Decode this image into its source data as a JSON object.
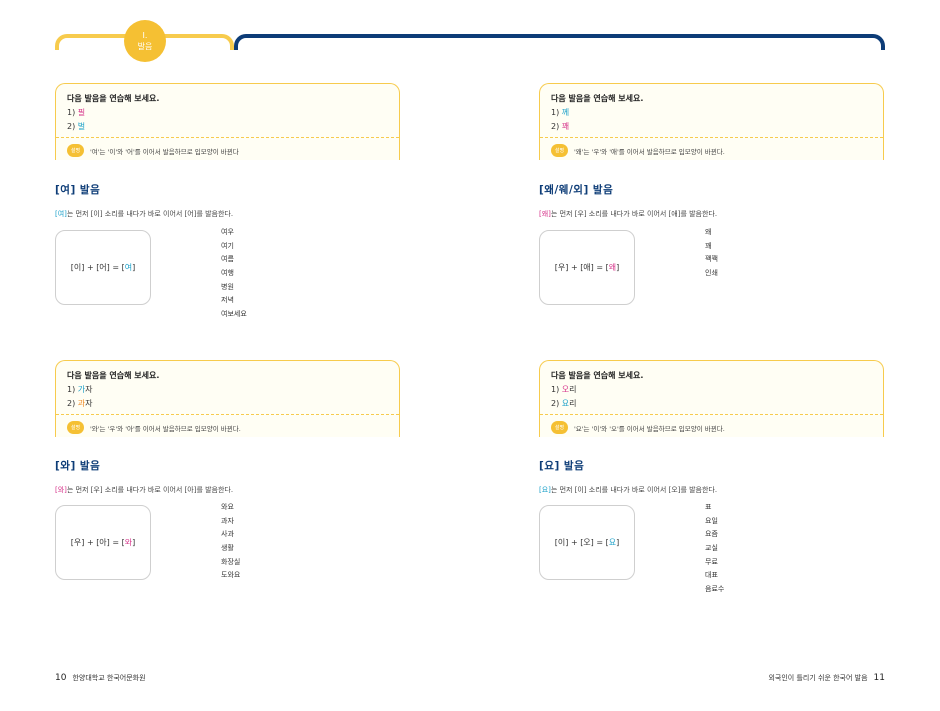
{
  "header": {
    "badge_num": "I.",
    "badge_label": "발음"
  },
  "blocks": [
    {
      "practice": {
        "title": "다음 발음을 연습해 보세요.",
        "items": [
          {
            "num": "1) ",
            "first": "필",
            "rest": ""
          },
          {
            "num": "2) ",
            "first": "벌",
            "rest": ""
          }
        ],
        "tip_badge": "설명",
        "tip": "'여'는 '이'와 '어'를 이어서 발음하므로 입모양이 바뀐다"
      },
      "section": "[여] 발음",
      "desc": {
        "hl": "[여]",
        "text": "는 먼저 [이] 소리를 내다가 바로 이어서 [어]를 발음한다."
      },
      "formula": {
        "left": "[이] + [어] = [",
        "hl": "여",
        "right": "]"
      },
      "words": [
        "여우",
        "여기",
        "여름",
        "여행",
        "병원",
        "저녁",
        "여보세요"
      ]
    },
    {
      "practice": {
        "title": "다음 발음을 연습해 보세요.",
        "items": [
          {
            "num": "1) ",
            "first": "께",
            "rest": ""
          },
          {
            "num": "2) ",
            "first": "꽤",
            "rest": ""
          }
        ],
        "tip_badge": "설명",
        "tip": "'왜'는 '우'와 '애'를 이어서 발음하므로 입모양이 바뀐다."
      },
      "section": "[왜/웨/외] 발음",
      "desc": {
        "hl": "[왜]",
        "text": "는 먼저 [우] 소리를 내다가 바로 이어서 [애]를 발음한다."
      },
      "formula": {
        "left": "[우] + [애] = [",
        "hl": "왜",
        "right": "]"
      },
      "words": [
        "왜",
        "꽤",
        "꽥꽥",
        "인쇄"
      ]
    },
    {
      "practice": {
        "title": "다음 발음을 연습해 보세요.",
        "items": [
          {
            "num": "1) ",
            "first": "가",
            "rest": "자"
          },
          {
            "num": "2) ",
            "first": "과",
            "rest": "자"
          }
        ],
        "tip_badge": "설명",
        "tip": "'와'는 '우'와 '아'를 이어서 발음하므로 입모양이 바뀐다."
      },
      "section": "[와] 발음",
      "desc": {
        "hl": "[와]",
        "text": "는 먼저 [우] 소리를 내다가 바로 이어서 [아]를 발음한다."
      },
      "formula": {
        "left": "[우] + [아] = [",
        "hl": "와",
        "right": "]"
      },
      "words": [
        "와요",
        "과자",
        "사과",
        "생활",
        "화장실",
        "도와요"
      ]
    },
    {
      "practice": {
        "title": "다음 발음을 연습해 보세요.",
        "items": [
          {
            "num": "1) ",
            "first": "오",
            "rest": "리"
          },
          {
            "num": "2) ",
            "first": "요",
            "rest": "리"
          }
        ],
        "tip_badge": "설명",
        "tip": "'요'는 '이'와 '오'를 이어서 발음하므로 입모양이 바뀐다."
      },
      "section": "[요] 발음",
      "desc": {
        "hl": "[요]",
        "text": "는 먼저 [이] 소리를 내다가 바로 이어서 [오]를 발음한다."
      },
      "formula": {
        "left": "[이] + [오] = [",
        "hl": "요",
        "right": "]"
      },
      "words": [
        "표",
        "요일",
        "요즘",
        "교실",
        "무료",
        "대표",
        "음료수"
      ]
    }
  ],
  "footer": {
    "left_page": "10",
    "left_text": "한양대학교 한국어문화원",
    "right_text": "외국인이 틀리기 쉬운 한국어 발음",
    "right_page": "11"
  }
}
